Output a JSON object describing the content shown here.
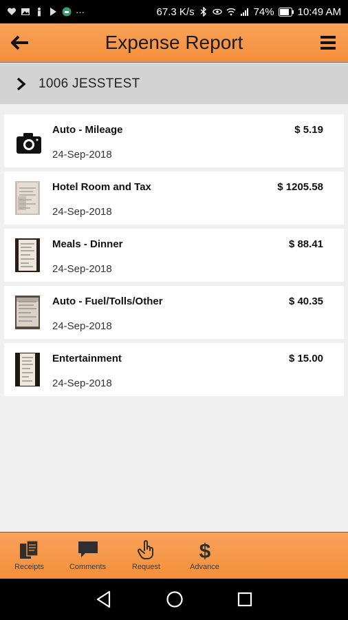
{
  "status": {
    "speed": "67.3 K/s",
    "battery": "74%",
    "time": "10:49 AM"
  },
  "header": {
    "title": "Expense Report"
  },
  "report": {
    "label": "1006 JESSTEST"
  },
  "expenses": [
    {
      "title": "Auto - Mileage",
      "date": "24-Sep-2018",
      "amount": "$ 5.19",
      "thumb": "camera-icon"
    },
    {
      "title": "Hotel Room and Tax",
      "date": "24-Sep-2018",
      "amount": "$ 1205.58",
      "thumb": "receipt-image"
    },
    {
      "title": "Meals - Dinner",
      "date": "24-Sep-2018",
      "amount": "$ 88.41",
      "thumb": "receipt-image"
    },
    {
      "title": "Auto - Fuel/Tolls/Other",
      "date": "24-Sep-2018",
      "amount": "$ 40.35",
      "thumb": "receipt-image"
    },
    {
      "title": "Entertainment",
      "date": "24-Sep-2018",
      "amount": "$ 15.00",
      "thumb": "receipt-image"
    }
  ],
  "tabs": [
    {
      "label": "Receipts",
      "icon": "receipts-icon"
    },
    {
      "label": "Comments",
      "icon": "comment-icon"
    },
    {
      "label": "Request",
      "icon": "hand-icon"
    },
    {
      "label": "Advance",
      "icon": "dollar-icon"
    }
  ],
  "colors": {
    "accent": "#f59440",
    "background": "#efefef",
    "subheader": "#d3d3d3"
  }
}
